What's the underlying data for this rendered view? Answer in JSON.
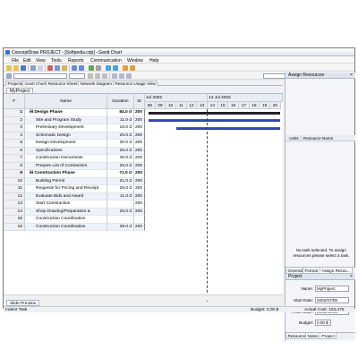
{
  "window": {
    "title": "ConceptDraw PROJECT - [Softpedia.cdp] - Gantt Chart"
  },
  "menu": [
    "File",
    "Edit",
    "View",
    "Tools",
    "Reports",
    "Communication",
    "Window",
    "Help"
  ],
  "view_tabs": [
    "Projects",
    "Gantt Chart",
    "Resource Sheet",
    "Network Diagram",
    "Resource Usage View"
  ],
  "doc_tab": "MyProject",
  "grid": {
    "headers": {
      "num": "#",
      "name": "Name",
      "duration": "Duration",
      "start_head": "St"
    },
    "rows": [
      {
        "num": "1",
        "name": "Design Phase",
        "duration": "84.0 d",
        "start": "200",
        "bold": true,
        "summary": true
      },
      {
        "num": "2",
        "name": "Site and Program Study",
        "duration": "11.0 d",
        "start": "200"
      },
      {
        "num": "3",
        "name": "Preliminary Development",
        "duration": "16.0 d",
        "start": "200"
      },
      {
        "num": "4",
        "name": "Schematic Design",
        "duration": "25.0 d",
        "start": "200"
      },
      {
        "num": "5",
        "name": "Design Development",
        "duration": "30.0 d",
        "start": "200"
      },
      {
        "num": "6",
        "name": "Specifications",
        "duration": "25.0 d",
        "start": "200"
      },
      {
        "num": "7",
        "name": "Construction Documents",
        "duration": "40.0 d",
        "start": "200"
      },
      {
        "num": "8",
        "name": "Prepare List of Contractors",
        "duration": "25.0 d",
        "start": "200"
      },
      {
        "num": "9",
        "name": "Construction Phase",
        "duration": "71.0 d",
        "start": "200",
        "bold": true,
        "summary": true
      },
      {
        "num": "10",
        "name": "Building Permit",
        "duration": "21.0 d",
        "start": "200"
      },
      {
        "num": "11",
        "name": "Requests for Pricing and Receipt",
        "duration": "28.0 d",
        "start": "200"
      },
      {
        "num": "12",
        "name": "Evaluate Bids and Award",
        "duration": "11.0 d",
        "start": "200"
      },
      {
        "num": "13",
        "name": "Start Construction",
        "duration": "",
        "start": "200"
      },
      {
        "num": "14",
        "name": "Shop Drawing/Preparation &",
        "duration": "25.0 d",
        "start": "200"
      },
      {
        "num": "15",
        "name": "Construction Coordination",
        "duration": "",
        "start": ""
      },
      {
        "num": "16",
        "name": "Construction Coordination",
        "duration": "39.0 d",
        "start": "200"
      }
    ]
  },
  "timeline": {
    "week1": "Jul 2002",
    "week2": "14 Jul 2002",
    "days": [
      "08",
      "09",
      "10",
      "11",
      "12",
      "13",
      "14",
      "15",
      "16",
      "17",
      "18",
      "19",
      "20"
    ],
    "bars": [
      {
        "row": 1,
        "start_day": 8.3,
        "end_day": 20.9,
        "kind": "summary"
      },
      {
        "row": 2,
        "start_day": 8.3,
        "end_day": 20.9,
        "kind": "task"
      },
      {
        "row": 3,
        "start_day": 11.0,
        "end_day": 20.9,
        "kind": "task"
      }
    ],
    "today_day": 13.95
  },
  "assign_panel": {
    "title": "Assign Resources",
    "col_units": "Units",
    "col_resource": "Resource Name",
    "message": "No task selected. To assign resources please select a task.",
    "tabs": [
      "General",
      "Format",
      "Assign Resou..."
    ]
  },
  "project_panel": {
    "title": "Project",
    "name_label": "Name:",
    "name_value": "MyProject",
    "start_label": "Start Date:",
    "start_value": "2002/07/08",
    "finish_label": "Finish Date:",
    "finish_value": "2002/09/14",
    "budget_label": "Budget:",
    "budget_value": "0.00 $",
    "tabs": [
      "Resource",
      "Notes",
      "Project"
    ]
  },
  "slide_preview": "Slide Preview",
  "status": {
    "left": "Indent Task",
    "budget": "Budget: 0.00 $",
    "actual": "Actual Cost: 104,475"
  },
  "colors": {
    "bar": "#2a3bb8",
    "summary": "#222222",
    "alt_row": "#eef2fb"
  }
}
